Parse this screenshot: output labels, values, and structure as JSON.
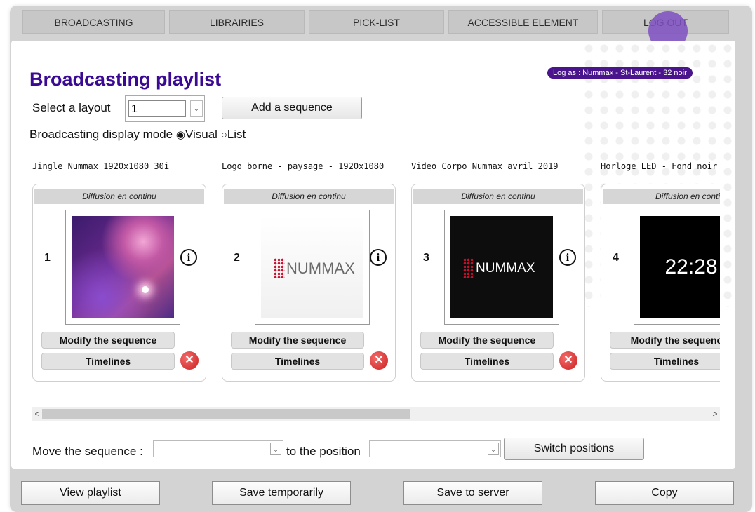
{
  "nav": {
    "tabs": [
      "BROADCASTING",
      "LIBRAIRIES",
      "PICK-LIST",
      "ACCESSIBLE ELEMENT",
      "LOG OUT"
    ]
  },
  "page": {
    "title": "Broadcasting playlist",
    "log_as": "Log as : Nummax - St-Laurent - 32 noir",
    "select_layout_label": "Select a layout",
    "layout_value": "1",
    "add_sequence_label": "Add a sequence",
    "display_mode_label": "Broadcasting display mode",
    "mode_visual": "Visual",
    "mode_list": "List",
    "mode_selected": "Visual"
  },
  "sequences": [
    {
      "name": "Jingle Nummax 1920x1080 30i",
      "header": "Diffusion en continu",
      "number": "1",
      "thumbnail": "abstract-purple-image",
      "modify_label": "Modify the sequence",
      "timelines_label": "Timelines"
    },
    {
      "name": "Logo borne - paysage - 1920x1080",
      "header": "Diffusion en continu",
      "number": "2",
      "thumbnail": "nummax-logo-light",
      "logo_text": "NUMMAX",
      "modify_label": "Modify the sequence",
      "timelines_label": "Timelines"
    },
    {
      "name": "Video Corpo Nummax avril 2019",
      "header": "Diffusion en continu",
      "number": "3",
      "thumbnail": "nummax-logo-dark",
      "logo_text": "NUMMAX",
      "modify_label": "Modify the sequence",
      "timelines_label": "Timelines"
    },
    {
      "name": "Horloge LED - Fond noir",
      "header": "Diffusion en conti",
      "number": "4",
      "thumbnail": "clock-black",
      "clock_text": "22:28",
      "modify_label": "Modify the sequenc",
      "timelines_label": "Timelines"
    }
  ],
  "move": {
    "label": "Move the sequence :",
    "to_label": "to the position",
    "switch_label": "Switch positions"
  },
  "footer": {
    "view_label": "View playlist",
    "save_temp_label": "Save temporarily",
    "save_server_label": "Save to server",
    "copy_label": "Copy"
  },
  "colors": {
    "title": "#3b0a94",
    "log_badge": "#4a148c",
    "delete": "#d12a2a",
    "accent_dot": "#7d4fc1"
  }
}
